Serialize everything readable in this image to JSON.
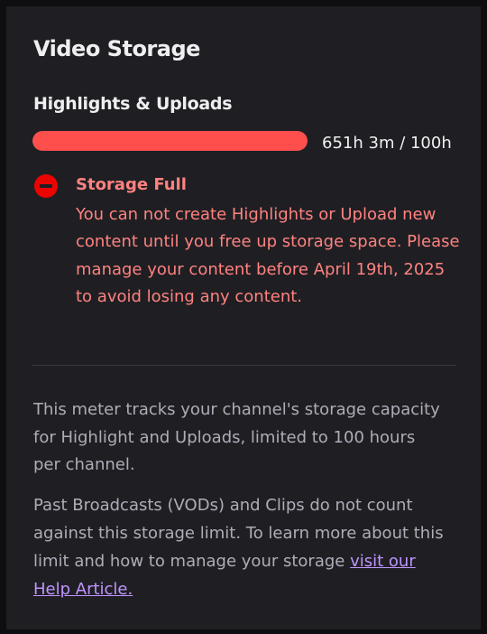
{
  "panel": {
    "title": "Video Storage",
    "section_title": "Highlights & Uploads"
  },
  "meter": {
    "fill_fraction": 1.0,
    "usage_text": "651h 3m / 100h",
    "fill_color": "#ff4f4d",
    "track_color": "#3a3a3d"
  },
  "alert": {
    "icon": "minus-circle-icon",
    "title": "Storage Full",
    "body": "You can not create Highlights or Upload new content until you free up storage space. Please manage your content before April 19th, 2025 to avoid losing any content.",
    "color": "#ff8280"
  },
  "info": {
    "paragraph1": "This meter tracks your channel's storage capacity for Highlight and Uploads, limited to 100 hours per channel.",
    "paragraph2_text": "Past Broadcasts (VODs) and Clips do not count against this storage limit. To learn more about this limit and how to manage your storage ",
    "help_link_label": "visit our Help Article.",
    "link_color": "#bf94ff"
  }
}
